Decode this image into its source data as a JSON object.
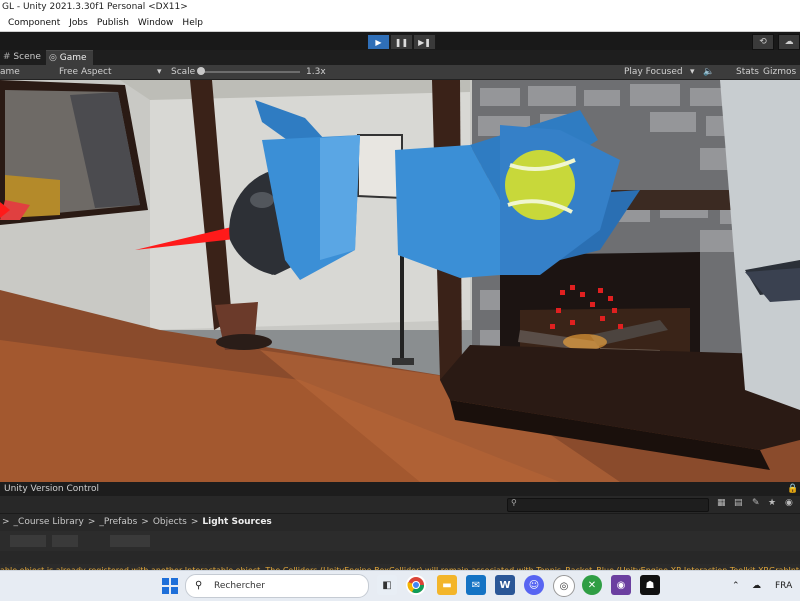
{
  "window": {
    "title": "GL - Unity 2021.3.30f1 Personal <DX11>"
  },
  "menu": {
    "items": [
      "Component",
      "Jobs",
      "Publish",
      "Window",
      "Help"
    ]
  },
  "toolbar": {
    "play_icon": "play-icon",
    "pause_icon": "pause-icon",
    "step_icon": "step-icon",
    "play_glyph": "▶",
    "pause_glyph": "❚❚",
    "step_glyph": "▶❚",
    "history_glyph": "⟲",
    "account_glyph": "☁"
  },
  "tabs": {
    "scene": "Scene",
    "game": "Game"
  },
  "gamebar": {
    "display": "ame",
    "aspect": "Free Aspect",
    "scale_label": "Scale",
    "scale_value": "1.3x",
    "play_mode": "Play Focused",
    "stats": "Stats",
    "gizmos": "Gizmos",
    "dropdown_glyph": "▾"
  },
  "console": {
    "header": "Unity Version Control",
    "lock_glyph": "🔒",
    "breadcrumb": [
      "_Course Library",
      "_Prefabs",
      "Objects",
      "Light Sources"
    ],
    "separator": ">",
    "counts": [
      "0",
      "0",
      "0"
    ],
    "message": "able object is already registered with another Interactable object. The Colliders (UnityEngine.BoxCollider) will remain associated with Tennis_Racket_Blue (UnityEngine.XR.Interaction.Toolkit.XRGrabInter"
  },
  "taskbar": {
    "search_placeholder": "Rechercher",
    "language": "FRA"
  },
  "colors": {
    "accent": "#2f6fb8",
    "warning": "#e1a73b",
    "editor_dark": "#202020"
  }
}
